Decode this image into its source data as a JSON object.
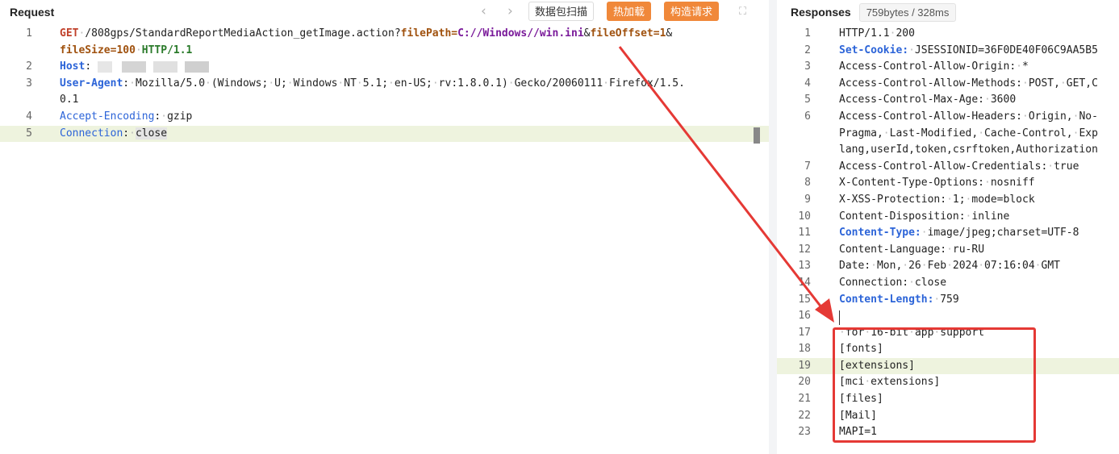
{
  "request": {
    "title": "Request",
    "nav_prev": "‹",
    "nav_next": "›",
    "buttons": {
      "scan": "数据包扫描",
      "hot_load": "热加载",
      "build": "构造请求"
    },
    "expand_icon": "expand-icon"
  },
  "response": {
    "title": "Responses",
    "meta": "759bytes / 328ms"
  }
}
